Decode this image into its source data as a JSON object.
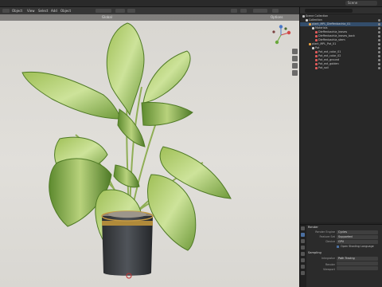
{
  "topbar": {
    "scene_name": "Scene"
  },
  "viewport": {
    "header_left_labels": [
      "Object",
      "View",
      "Select",
      "Add",
      "Object"
    ],
    "header_right_label": "Options",
    "mode_label": "Global"
  },
  "outliner": {
    "root": "Scene Collection",
    "items": [
      {
        "label": "Collection",
        "depth": 1,
        "color": "#d0d0d0",
        "icon": "collection-icon"
      },
      {
        "label": "plant_MPL_Dieffenbachia_01",
        "depth": 2,
        "color": "#e8a040",
        "icon": "object-icon"
      },
      {
        "label": "Materials",
        "depth": 3,
        "color": "#d0d0d0",
        "icon": "material-icon"
      },
      {
        "label": "Dieffenbachia_leaves",
        "depth": 4,
        "color": "#e05a5a",
        "icon": "material-icon"
      },
      {
        "label": "Dieffenbachia_leaves_back",
        "depth": 4,
        "color": "#e05a5a",
        "icon": "material-icon"
      },
      {
        "label": "Dieffenbachia_stem",
        "depth": 4,
        "color": "#e05a5a",
        "icon": "material-icon"
      },
      {
        "label": "plant_MPL_Pot_01",
        "depth": 2,
        "color": "#e8a040",
        "icon": "object-icon"
      },
      {
        "label": "Pot",
        "depth": 3,
        "color": "#d0d0d0",
        "icon": "mesh-icon"
      },
      {
        "label": "Pot_ext_color_01",
        "depth": 4,
        "color": "#e05a5a",
        "icon": "material-icon"
      },
      {
        "label": "Pot_ext_color_02",
        "depth": 4,
        "color": "#e05a5a",
        "icon": "material-icon"
      },
      {
        "label": "Pot_ext_ground",
        "depth": 4,
        "color": "#e05a5a",
        "icon": "material-icon"
      },
      {
        "label": "Pot_ext_golden",
        "depth": 4,
        "color": "#e05a5a",
        "icon": "material-icon"
      },
      {
        "label": "Pot_soil",
        "depth": 4,
        "color": "#e05a5a",
        "icon": "material-icon"
      }
    ]
  },
  "properties": {
    "section_render": "Render",
    "rows": [
      {
        "label": "Render Engine",
        "value": "Cycles"
      },
      {
        "label": "Feature Set",
        "value": "Supported"
      },
      {
        "label": "Device",
        "value": "GPU"
      }
    ],
    "open_shading_label": "Open Shading Language",
    "section_sampling": "Sampling",
    "rows2": [
      {
        "label": "Integrator",
        "value": "Path Tracing"
      },
      {
        "label": "Render",
        "value": ""
      },
      {
        "label": "Viewport",
        "value": ""
      }
    ]
  }
}
